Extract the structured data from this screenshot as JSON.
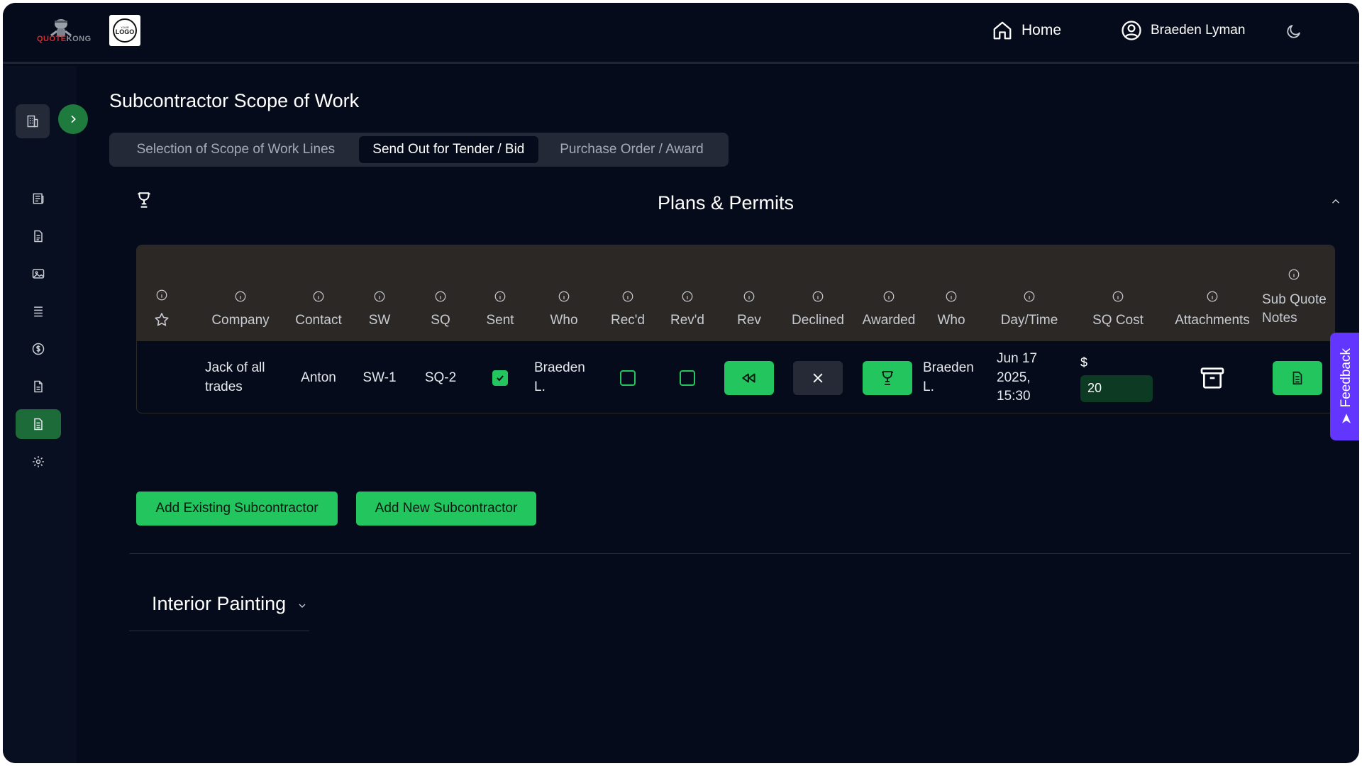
{
  "header": {
    "brand_name_a": "QUOTE",
    "brand_name_b": "KONG",
    "company_logo_text": "LOGO",
    "company_logo_small": "YOUR",
    "home_label": "Home",
    "user_name": "Braeden Lyman"
  },
  "sidebar": {
    "items": [
      {
        "icon": "building-icon"
      },
      {
        "icon": "newspaper-icon"
      },
      {
        "icon": "document-icon"
      },
      {
        "icon": "image-icon"
      },
      {
        "icon": "list-icon"
      },
      {
        "icon": "dollar-icon"
      },
      {
        "icon": "file-icon"
      },
      {
        "icon": "document-text-icon",
        "active": true
      },
      {
        "icon": "gear-icon"
      }
    ]
  },
  "page": {
    "title": "Subcontractor Scope of Work",
    "tabs": [
      {
        "label": "Selection of Scope of Work Lines"
      },
      {
        "label": "Send Out for Tender / Bid",
        "active": true
      },
      {
        "label": "Purchase Order / Award"
      }
    ]
  },
  "section": {
    "title": "Plans & Permits",
    "columns": {
      "company": "Company",
      "contact": "Contact",
      "sw": "SW",
      "sq": "SQ",
      "sent": "Sent",
      "who": "Who",
      "recd": "Rec'd",
      "revd": "Rev'd",
      "rev": "Rev",
      "declined": "Declined",
      "awarded": "Awarded",
      "who2": "Who",
      "daytime": "Day/Time",
      "sq_cost": "SQ Cost",
      "attachments": "Attachments",
      "sub_quote_notes_1": "Sub Quote",
      "sub_quote_notes_2": "Notes"
    },
    "row": {
      "company_1": "Jack of all",
      "company_2": "trades",
      "contact": "Anton",
      "sw": "SW-1",
      "sq": "SQ-2",
      "sent": true,
      "who_1": "Braeden",
      "who_2": "L.",
      "recd": false,
      "revd": false,
      "awarded_who_1": "Braeden",
      "awarded_who_2": "L.",
      "daytime_1": "Jun 17",
      "daytime_2": "2025,",
      "daytime_3": "15:30",
      "currency": "$",
      "sq_cost": "20"
    },
    "add_existing_label": "Add Existing Subcontractor",
    "add_new_label": "Add New Subcontractor"
  },
  "next_section": {
    "title": "Interior Painting"
  },
  "feedback_label": "Feedback",
  "colors": {
    "background": "#050b1a",
    "accent_green": "#22c55e",
    "feedback_purple": "#6236ff",
    "table_header": "#2b2825"
  }
}
